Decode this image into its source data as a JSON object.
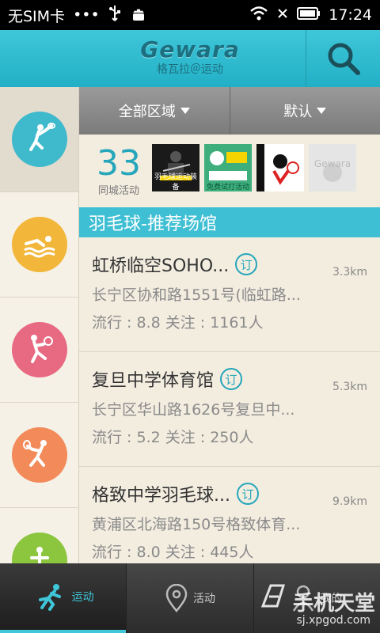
{
  "status_bar": {
    "carrier": "无SIM卡",
    "dots": "•••",
    "time": "17:24",
    "icons": [
      "usb-icon",
      "android-icon",
      "wifi-icon",
      "no-signal-icon",
      "battery-icon"
    ]
  },
  "header": {
    "logo_main": "Gewara",
    "logo_sub": "格瓦拉＠运动",
    "search_icon": "search-icon"
  },
  "rail": {
    "items": [
      {
        "name": "badminton",
        "color": "#3fb9cc",
        "active": true
      },
      {
        "name": "swimming",
        "color": "#f2b63a"
      },
      {
        "name": "tennis",
        "color": "#e76a82"
      },
      {
        "name": "squash",
        "color": "#f28a5a"
      },
      {
        "name": "fitness",
        "color": "#8cc63f"
      }
    ]
  },
  "filters": {
    "region": "全部区域",
    "sort": "默认"
  },
  "activities": {
    "count": "33",
    "label": "同城活动",
    "thumbs": [
      {
        "caption": "羽毛球运动装备",
        "bg": "#1a1a1a"
      },
      {
        "caption": "免费试打活动",
        "bg": "#3fae7d"
      },
      {
        "caption": "",
        "bg": "#ffffff"
      },
      {
        "caption": "Gewara",
        "bg": "#e5e5e5"
      }
    ]
  },
  "section": {
    "title": "羽毛球-推荐场馆"
  },
  "venues": [
    {
      "name": "虹桥临空SOHO...",
      "badge": "订",
      "distance": "3.3km",
      "address": "长宁区协和路1551号(临虹路...",
      "stats": "流行 : 8.8  关注 : 1161人"
    },
    {
      "name": "复旦中学体育馆",
      "badge": "订",
      "distance": "5.3km",
      "address": "长宁区华山路1626号复旦中...",
      "stats": "流行 : 5.2  关注 : 250人"
    },
    {
      "name": "格致中学羽毛球...",
      "badge": "订",
      "distance": "9.9km",
      "address": "黄浦区北海路150号格致体育...",
      "stats": "流行 : 8.0  关注 : 445人"
    }
  ],
  "bottom_nav": {
    "tabs": [
      {
        "label": "运动",
        "icon": "runner-icon",
        "active": true
      },
      {
        "label": "活动",
        "icon": "location-pin-icon"
      },
      {
        "label": "我的",
        "icon": "person-icon"
      }
    ]
  },
  "watermark": {
    "main": "手机天堂",
    "sub": "sj.xpgod.com"
  },
  "colors": {
    "accent": "#3fc6d9",
    "section_bg": "#3fbfd3",
    "page_bg": "#f3ede0"
  }
}
